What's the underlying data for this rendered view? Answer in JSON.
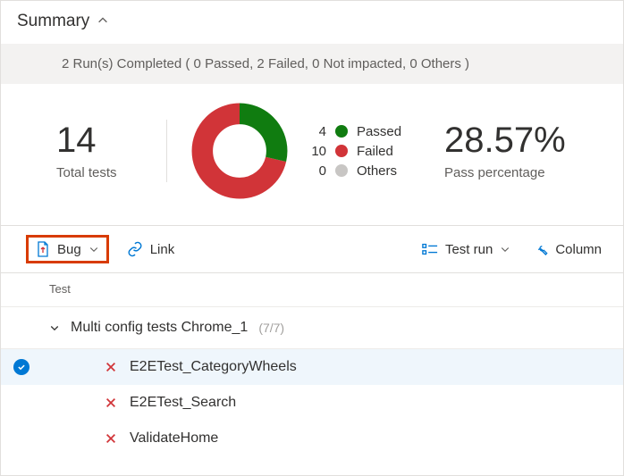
{
  "header": {
    "title": "Summary"
  },
  "status_bar": "2 Run(s) Completed ( 0 Passed, 2 Failed, 0 Not impacted, 0 Others )",
  "metrics": {
    "total": {
      "value": "14",
      "label": "Total tests"
    },
    "pct": {
      "value": "28.57%",
      "label": "Pass percentage"
    }
  },
  "chart_data": {
    "type": "pie",
    "title": "",
    "series": [
      {
        "name": "Passed",
        "value": 4,
        "color": "#107c10"
      },
      {
        "name": "Failed",
        "value": 10,
        "color": "#d13438"
      },
      {
        "name": "Others",
        "value": 0,
        "color": "#c8c6c4"
      }
    ]
  },
  "legend": {
    "passed": {
      "count": "4",
      "label": "Passed"
    },
    "failed": {
      "count": "10",
      "label": "Failed"
    },
    "others": {
      "count": "0",
      "label": "Others"
    }
  },
  "toolbar": {
    "bug": "Bug",
    "link": "Link",
    "test_run": "Test run",
    "column": "Column"
  },
  "columns": {
    "test": "Test"
  },
  "group": {
    "name": "Multi config tests Chrome_1",
    "count": "(7/7)"
  },
  "tests": {
    "t1": "E2ETest_CategoryWheels",
    "t2": "E2ETest_Search",
    "t3": "ValidateHome"
  }
}
